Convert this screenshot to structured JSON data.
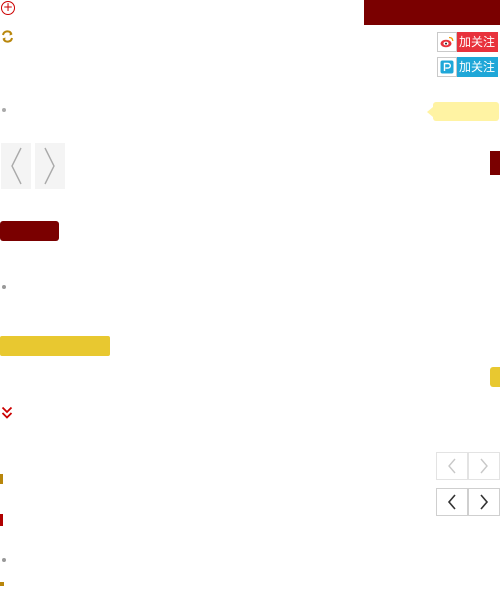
{
  "social": {
    "weibo_follow_label": "加关注",
    "pp_follow_label": "加关注"
  },
  "icons": {
    "plus": "plus-circle-icon",
    "swap": "swap-icon",
    "weibo": "weibo-icon",
    "pp": "pp-icon",
    "chevron": "double-chevron-down-icon",
    "prev": "chevron-left-icon",
    "next": "chevron-right-icon"
  },
  "colors": {
    "brand_dark_red": "#7a0000",
    "accent_yellow": "#e8c830",
    "tooltip_yellow": "#fff3a3",
    "weibo_red": "#e8323c",
    "pp_blue": "#1fa7d8"
  }
}
